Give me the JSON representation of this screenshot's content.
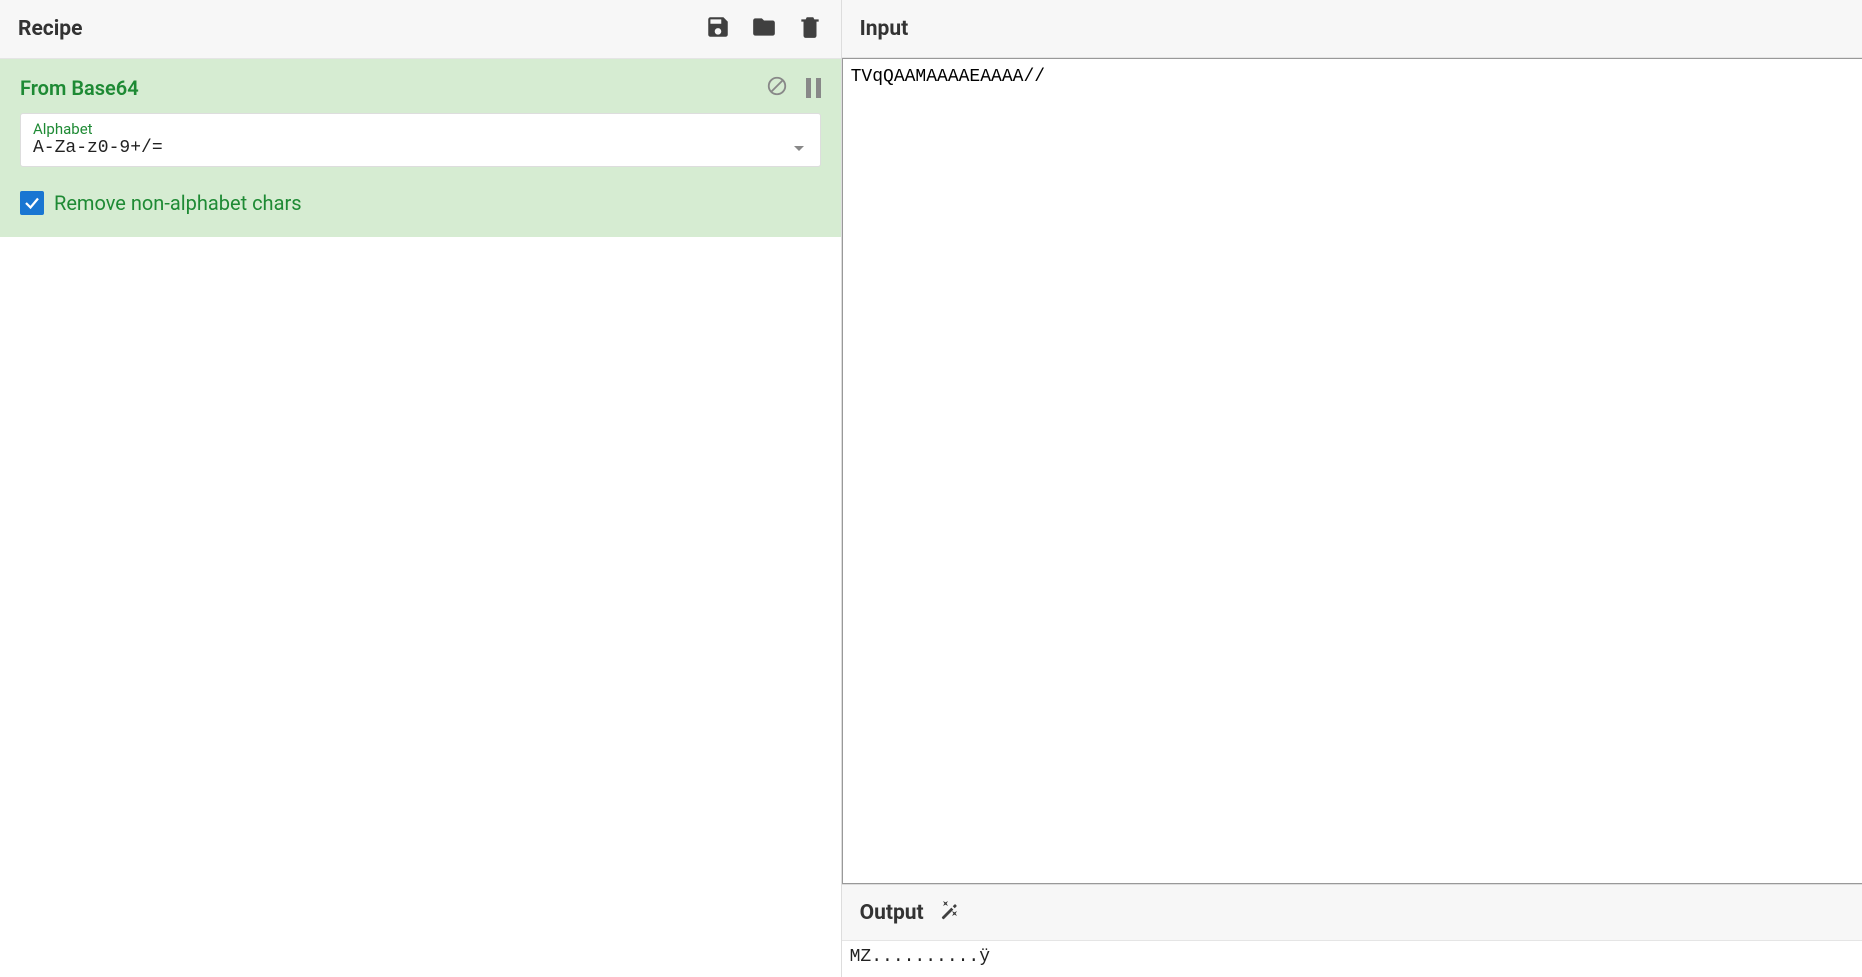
{
  "recipe": {
    "title": "Recipe",
    "operation": {
      "name": "From Base64",
      "alphabet_label": "Alphabet",
      "alphabet_value": "A-Za-z0-9+/=",
      "remove_label": "Remove non-alphabet chars",
      "remove_checked": true
    }
  },
  "input": {
    "title": "Input",
    "value": "TVqQAAMAAAAEAAAA//"
  },
  "output": {
    "title": "Output",
    "value": "MZ..........ÿ"
  }
}
